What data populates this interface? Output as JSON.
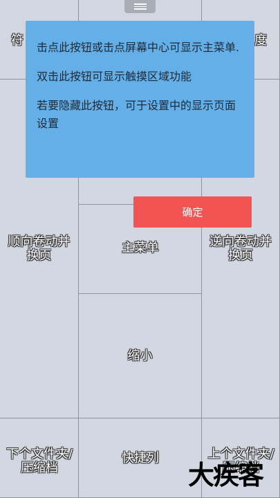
{
  "zones": {
    "top_left": "符",
    "top_right": "度",
    "scroll_forward": "顺向卷动并\n换页",
    "main_menu": "主菜单",
    "scroll_backward": "逆向卷动并\n换页",
    "shrink": "缩小",
    "next_folder": "下个文件夹/\n压缩档",
    "shortcut_bar": "快捷列",
    "prev_folder": "上个文件夹/\n压缩档"
  },
  "tooltip": {
    "line1": "击点此按钮或击点屏幕中心可显示主菜单.",
    "line2": "双击此按钮可显示触摸区域功能",
    "line3": "若要隐藏此按钮，可于设置中的显示页面设置"
  },
  "confirm_label": "确定",
  "watermark": "大疾客",
  "colors": {
    "background": "#d3d7e1",
    "tooltip": "#65afe8",
    "confirm": "#f25353"
  }
}
